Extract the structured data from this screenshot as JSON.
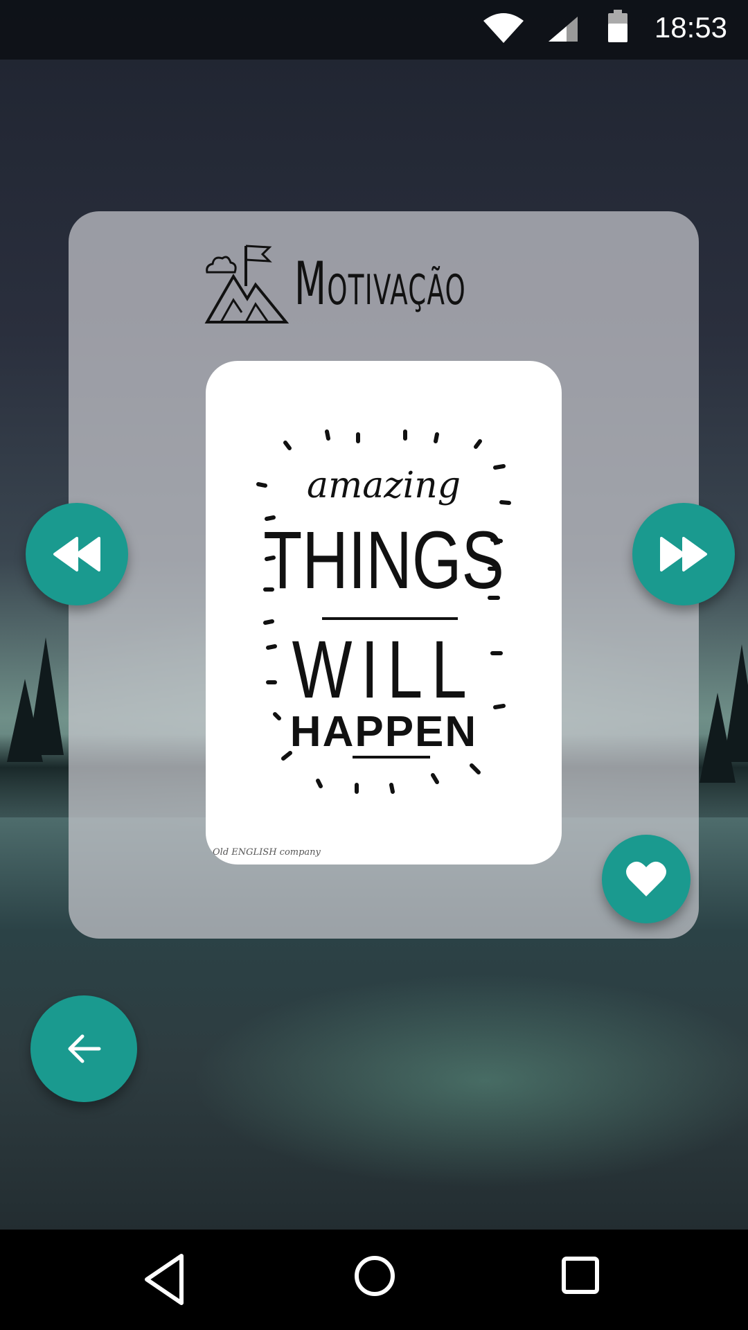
{
  "status_bar": {
    "time": "18:53",
    "icons": [
      "wifi-icon",
      "signal-icon",
      "battery-icon"
    ]
  },
  "card": {
    "title": "Motivação",
    "title_icon": "mountain-flag-icon",
    "quote": {
      "line1": "amazing",
      "line2": "THINGS",
      "line3": "WILL",
      "line4": "HAPPEN",
      "credit": "Old ENGLISH company"
    }
  },
  "buttons": {
    "previous": "rewind-icon",
    "next": "fast-forward-icon",
    "favorite": "heart-icon",
    "back": "arrow-left-icon"
  },
  "nav_bar": {
    "back": "nav-back-icon",
    "home": "nav-home-icon",
    "recents": "nav-recents-icon"
  },
  "colors": {
    "accent": "#1a9a8f",
    "panel": "#c8c8cd"
  }
}
